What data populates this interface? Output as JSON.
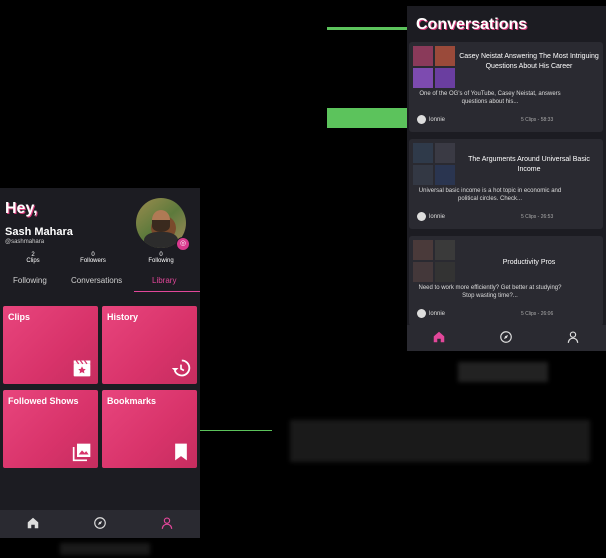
{
  "profile": {
    "greeting": "Hey,",
    "name": "Sash Mahara",
    "handle": "@sashmahara",
    "stats": [
      {
        "value": "2",
        "label": "Clips"
      },
      {
        "value": "0",
        "label": "Followers"
      },
      {
        "value": "0",
        "label": "Following"
      }
    ],
    "tabs": [
      "Following",
      "Conversations",
      "Library"
    ],
    "active_tab": "Library",
    "tiles": [
      {
        "label": "Clips",
        "icon": "clapperboard-icon"
      },
      {
        "label": "History",
        "icon": "history-icon"
      },
      {
        "label": "Followed Shows",
        "icon": "gallery-icon"
      },
      {
        "label": "Bookmarks",
        "icon": "bookmark-icon"
      }
    ],
    "nav": [
      "home-icon",
      "compass-icon",
      "profile-icon"
    ]
  },
  "conversations": {
    "title": "Conversations",
    "cards": [
      {
        "title": "Casey Neistat Answering The Most Intriguing Questions About His Career",
        "description": "One of the OG's of YouTube, Casey Neistat, answers questions about his...",
        "user": "lonnie",
        "meta": "5 Clips - 58:33"
      },
      {
        "title": "The Arguments Around Universal Basic Income",
        "description": "Universal basic income is a hot topic in economic and political circles. Check...",
        "user": "lonnie",
        "meta": "5 Clips - 26:53"
      },
      {
        "title": "Productivity Pros",
        "description": "Need to work more efficiently? Get better at studying? Stop wasting time?...",
        "user": "lonnie",
        "meta": "5 Clips - 26:06"
      }
    ],
    "nav": [
      "home-icon",
      "compass-icon",
      "profile-icon"
    ]
  },
  "colors": {
    "accent": "#e2479a",
    "tile": "#e8457d",
    "annotation": "#5cc35c",
    "panel": "#1c1c22",
    "card": "#2a2a31"
  }
}
